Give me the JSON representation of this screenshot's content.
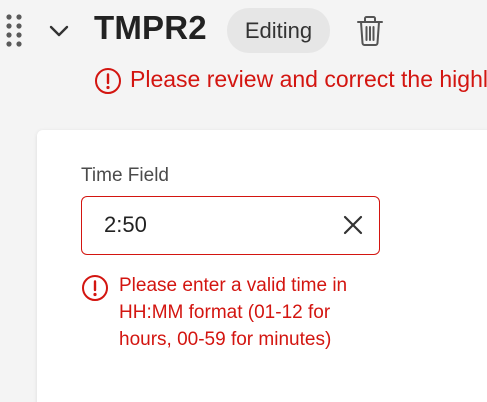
{
  "header": {
    "title": "TMPR2",
    "status_badge": "Editing",
    "alert_text": "Please review and correct the highlighted fields"
  },
  "icons": {
    "drag": "drag-handle-icon",
    "chevron": "chevron-down-icon",
    "trash": "trash-icon",
    "alert": "alert-circle-icon",
    "clear": "close-icon"
  },
  "form": {
    "time_field": {
      "label": "Time Field",
      "value": "2:50",
      "error": "Please enter a valid time in HH:MM format (01-12 for hours, 00-59 for minutes)"
    }
  },
  "colors": {
    "error": "#d31510",
    "text": "#222222",
    "badge_bg": "#e6e6e6"
  }
}
